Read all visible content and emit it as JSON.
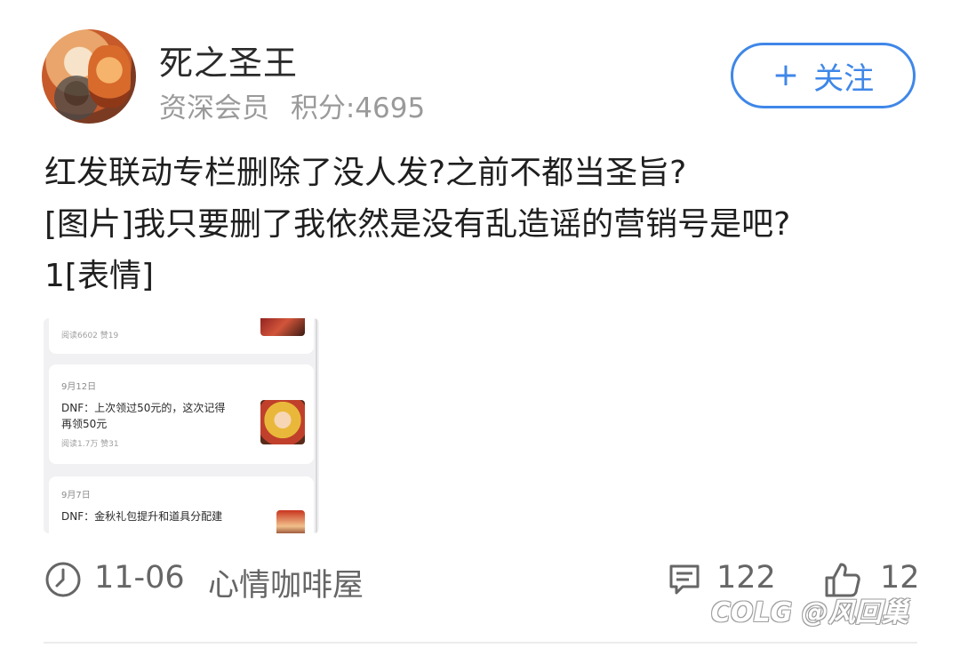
{
  "author": {
    "name": "死之圣王",
    "level": "资深会员",
    "points": "积分:4695"
  },
  "follow_button": {
    "plus": "+",
    "label": "关注"
  },
  "post": {
    "line1": "红发联动专栏删除了没人发?之前不都当圣旨?",
    "line2": " [图片]我只要删了我依然是没有乱造谣的营销号是吧?",
    "line3": "1[表情]"
  },
  "embedded_image": {
    "card_a_stats": "阅读6602  赞19",
    "card_b_date": "9月12日",
    "card_b_title_1": "DNF：上次领过50元的，这次记得",
    "card_b_title_2": "再领50元",
    "card_b_stats": "阅读1.7万  赞31",
    "card_c_date": "9月7日",
    "card_c_title": "DNF：金秋礼包提升和道具分配建"
  },
  "footer": {
    "time": "11-06",
    "board": "心情咖啡屋",
    "comments": "122",
    "likes": "12"
  },
  "watermark": "COLG @风回巢",
  "icons": {
    "clock": "clock-icon",
    "comment": "comment-icon",
    "like": "thumbs-up-icon"
  },
  "colors": {
    "accent": "#3f87e8"
  }
}
